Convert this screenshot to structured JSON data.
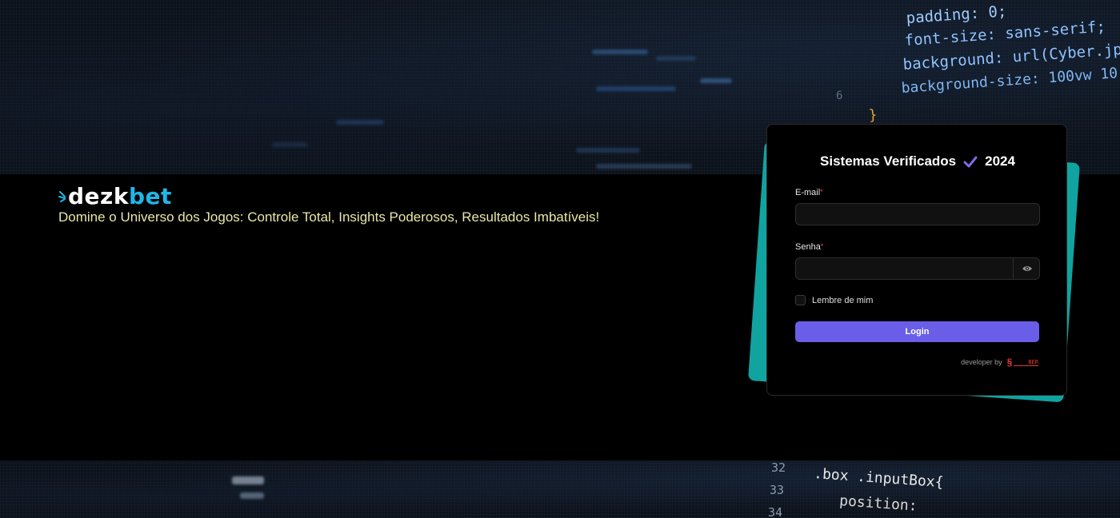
{
  "background": {
    "code_top": [
      "padding: 0;",
      "font-size: sans-serif;",
      "background: url(Cyber.jpg",
      "background-size: 100vw 10",
      "}"
    ],
    "line_number_top": "6",
    "code_bottom": {
      "line_numbers": [
        "32",
        "33",
        "34"
      ],
      "lines": [
        ".box .inputBox{",
        "position:"
      ]
    }
  },
  "brand": {
    "logo_part1": "dezk",
    "logo_part2": "bet",
    "tagline": "Domine o Universo dos Jogos: Controle Total, Insights Poderosos, Resultados Imbatíveis!"
  },
  "login": {
    "title": "Sistemas Verificados",
    "year": "2024",
    "email_label": "E-mail",
    "email_value": "",
    "password_label": "Senha",
    "password_value": "",
    "required_mark": "*",
    "remember_label": "Lembre de mim",
    "remember_checked": false,
    "submit_label": "Login",
    "developer_text": "developer by",
    "developer_logo_text": "BER"
  },
  "colors": {
    "accent": "#6a5ee8",
    "brand_blue": "#1fb6e8",
    "teal": "#10a3a0",
    "tagline": "#e9e7a8"
  },
  "icons": [
    "check-icon",
    "eye-icon",
    "logo-splash-icon"
  ]
}
